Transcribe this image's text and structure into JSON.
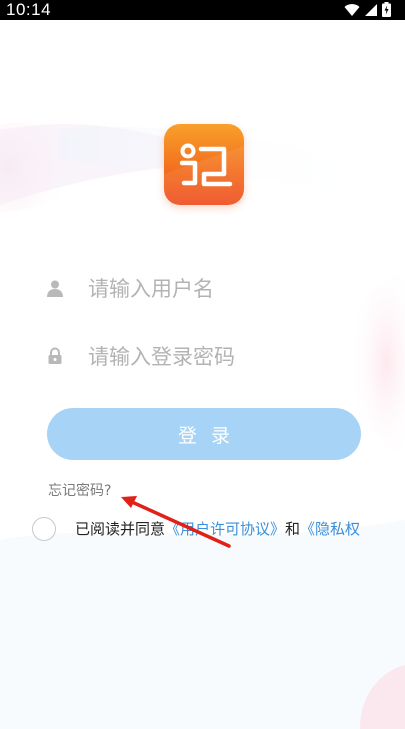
{
  "status_bar": {
    "time": "10:14",
    "icons": [
      "wifi-icon",
      "cellular-signal-icon",
      "battery-charging-icon"
    ]
  },
  "logo": {
    "icon": "app-logo-icon"
  },
  "login_form": {
    "username": {
      "value": "",
      "placeholder": "请输入用户名",
      "icon": "user-icon"
    },
    "password": {
      "value": "",
      "placeholder": "请输入登录密码",
      "icon": "lock-icon"
    },
    "login_label": "登录",
    "forgot_password": "忘记密码?"
  },
  "agreement": {
    "checked": false,
    "prefix": "已阅读并同意",
    "user_agreement": "《用户许可协议》",
    "conjunction": "和",
    "privacy_policy": "《隐私权"
  },
  "colors": {
    "login_button": "#a7d4f6",
    "link": "#3a8fdc",
    "logo_orange": "#f26c1e",
    "annotation_arrow": "#e0211a"
  }
}
